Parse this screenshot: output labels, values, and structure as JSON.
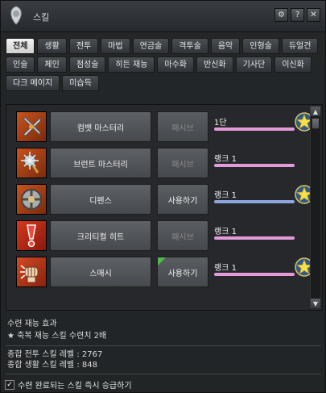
{
  "window": {
    "title": "스킬",
    "title_icon": "skill-emblem-icon",
    "buttons": [
      "settings-icon",
      "help-icon",
      "close-icon"
    ]
  },
  "tabs": {
    "row1": [
      "전체",
      "생활",
      "전투",
      "마법",
      "연금술",
      "격투술",
      "음악",
      "인형술",
      "듀얼건"
    ],
    "row2": [
      "인술",
      "체인",
      "점성술",
      "히든 재능",
      "마수화",
      "반신화",
      "기사단",
      "이신화"
    ],
    "row3": [
      "다크 메이지",
      "미습득"
    ],
    "active": "전체"
  },
  "skills": [
    {
      "name": "컴뱃 마스터리",
      "action": "패시브",
      "action_enabled": false,
      "rank": "1단",
      "bar_color": "#e29ad9",
      "has_star": true,
      "has_corner": false,
      "icon": "combat-mastery-swords-icon"
    },
    {
      "name": "브런트 마스터리",
      "action": "패시브",
      "action_enabled": false,
      "rank": "랭크 1",
      "bar_color": "#e29ad9",
      "has_star": false,
      "has_corner": false,
      "icon": "blunt-mastery-mace-icon"
    },
    {
      "name": "디펜스",
      "action": "사용하기",
      "action_enabled": true,
      "rank": "랭크 1",
      "bar_color": "#8ea6e0",
      "has_star": true,
      "has_corner": false,
      "icon": "defense-shield-icon"
    },
    {
      "name": "크리티컬 히트",
      "action": "패시브",
      "action_enabled": false,
      "rank": "랭크 1",
      "bar_color": "#e29ad9",
      "has_star": false,
      "has_corner": false,
      "icon": "critical-hit-exclamation-icon"
    },
    {
      "name": "스매시",
      "action": "사용하기",
      "action_enabled": true,
      "rank": "랭크 1",
      "bar_color": "#e29ad9",
      "has_star": true,
      "has_corner": true,
      "icon": "smash-fist-icon"
    }
  ],
  "info": {
    "training_effect_title": "수련 재능 효과",
    "training_effect_line": "★ 축복 재능 스킬 수련치 2배",
    "combat_level": "종합 전투 스킬 레벨 : 2767",
    "life_level": "종합 생활 스킬 레벨 : 848",
    "auto_promote_label": "수련 완료되는 스킬 즉시 승급하기",
    "auto_promote_checked": true
  }
}
